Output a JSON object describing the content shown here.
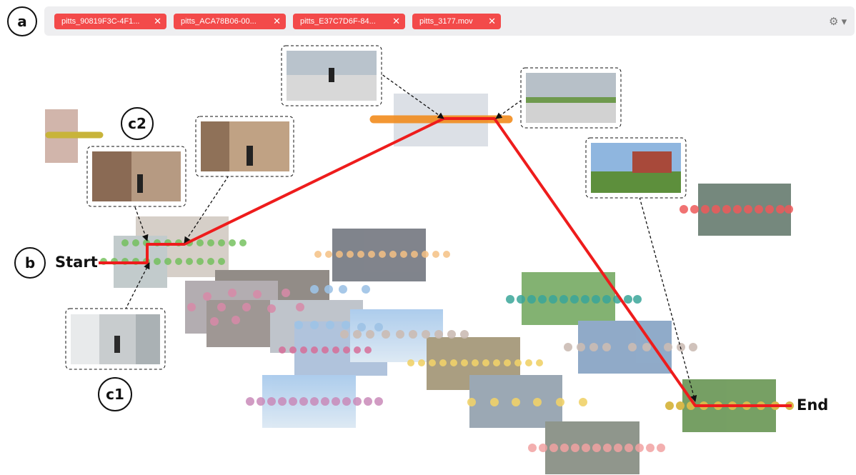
{
  "labels": {
    "a": "a",
    "b": "b",
    "c1": "c1",
    "c2": "c2",
    "start": "Start",
    "end": "End"
  },
  "tabs": [
    {
      "label": "pitts_90819F3C-4F1..."
    },
    {
      "label": "pitts_ACA78B06-00..."
    },
    {
      "label": "pitts_E37C7D6F-84..."
    },
    {
      "label": "pitts_3177.mov"
    }
  ],
  "close_glyph": "✕",
  "settings_glyph": "⚙ ▾",
  "colors": {
    "route": "#ee1c1c",
    "tag": "#f34a4a",
    "green": "#6fbf57",
    "olive": "#c8b43a",
    "orange": "#f28c1e",
    "peach": "#f5c184",
    "pink": "#d88aa8",
    "blue": "#9ec3e6",
    "yellow": "#f0d26a",
    "mauve": "#c98ab9",
    "salmon": "#f1a2a2",
    "teal": "#3aa69a",
    "grey": "#cbbcb4",
    "red": "#ee5a5a",
    "gold": "#d8b94a"
  },
  "icons": [
    "settings-gear-icon",
    "chevron-down-icon",
    "close-icon"
  ]
}
